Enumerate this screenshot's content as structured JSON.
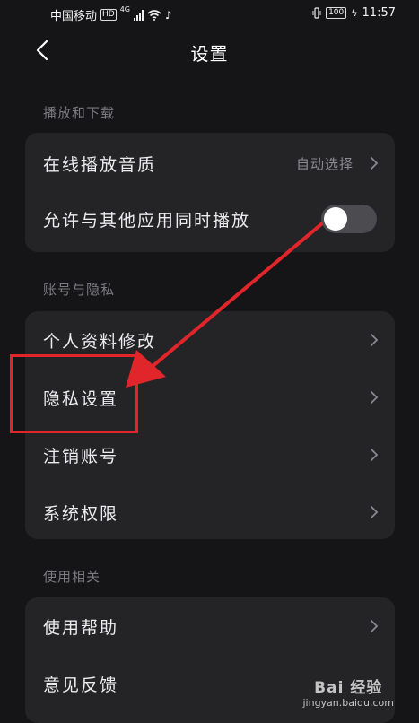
{
  "status_bar": {
    "carrier": "中国移动",
    "hd": "HD",
    "network": "4G",
    "battery": "100",
    "time": "11:57"
  },
  "header": {
    "title": "设置",
    "back_icon": "chevron-left-icon"
  },
  "sections": {
    "playback": {
      "title": "播放和下载",
      "items": [
        {
          "label": "在线播放音质",
          "value": "自动选择"
        },
        {
          "label": "允许与其他应用同时播放",
          "toggle_on": false
        }
      ]
    },
    "account": {
      "title": "账号与隐私",
      "items": [
        {
          "label": "个人资料修改"
        },
        {
          "label": "隐私设置"
        },
        {
          "label": "注销账号"
        },
        {
          "label": "系统权限"
        }
      ]
    },
    "usage": {
      "title": "使用相关",
      "items": [
        {
          "label": "使用帮助"
        },
        {
          "label": "意见反馈"
        }
      ]
    }
  },
  "watermark": {
    "logo": "Bai 经验",
    "url": "jingyan.baidu.com"
  },
  "colors": {
    "background": "#151416",
    "card": "#242326",
    "annotation": "#e0262b"
  }
}
